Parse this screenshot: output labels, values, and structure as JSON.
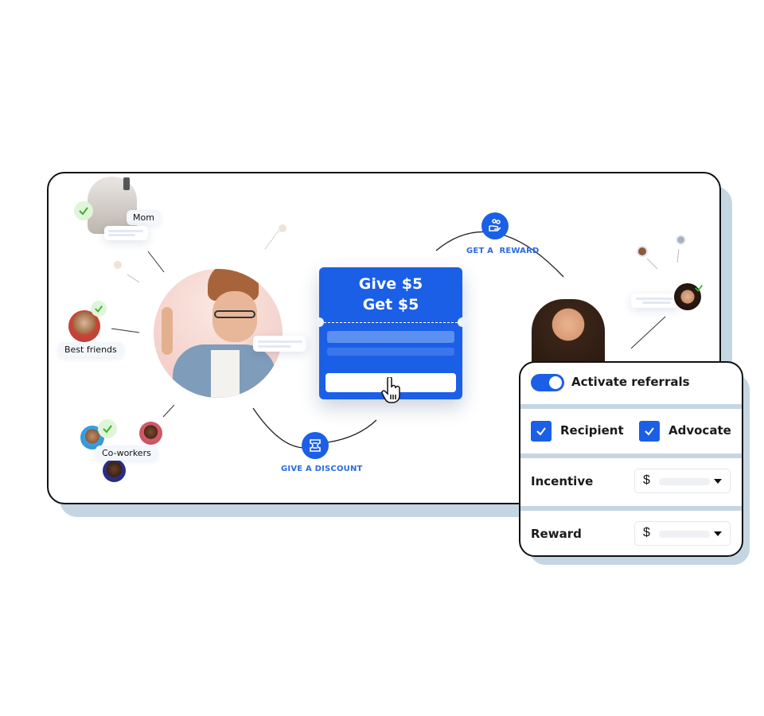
{
  "colors": {
    "accent": "#1b5fe6",
    "shadow": "#c5d6e3",
    "check_green": "#3fae2a",
    "label_blue": "#2b6be0"
  },
  "network": {
    "contacts": [
      {
        "label": "Mom",
        "checked": true,
        "icon": "person-photo"
      },
      {
        "label": "Best friends",
        "checked": true,
        "icon": "person-photo"
      },
      {
        "label": "Co-workers",
        "checked": true,
        "icon": "group-photo"
      }
    ],
    "center_person": "advocate-photo",
    "right_person": "recipient-photo"
  },
  "flow": {
    "get_reward_label": "GET A  REWARD",
    "get_reward_icon": "hand-coins-icon",
    "give_discount_label": "GIVE A DISCOUNT",
    "give_discount_icon": "ticket-icon"
  },
  "coupon": {
    "line1": "Give $5",
    "line2": "Get $5",
    "cursor_icon": "hand-pointer-icon"
  },
  "panel": {
    "toggle_label": "Activate referrals",
    "toggle_on": true,
    "checkboxes": [
      {
        "label": "Recipient",
        "checked": true
      },
      {
        "label": "Advocate",
        "checked": true
      }
    ],
    "incentive": {
      "label": "Incentive",
      "currency": "$"
    },
    "reward": {
      "label": "Reward",
      "currency": "$"
    }
  }
}
